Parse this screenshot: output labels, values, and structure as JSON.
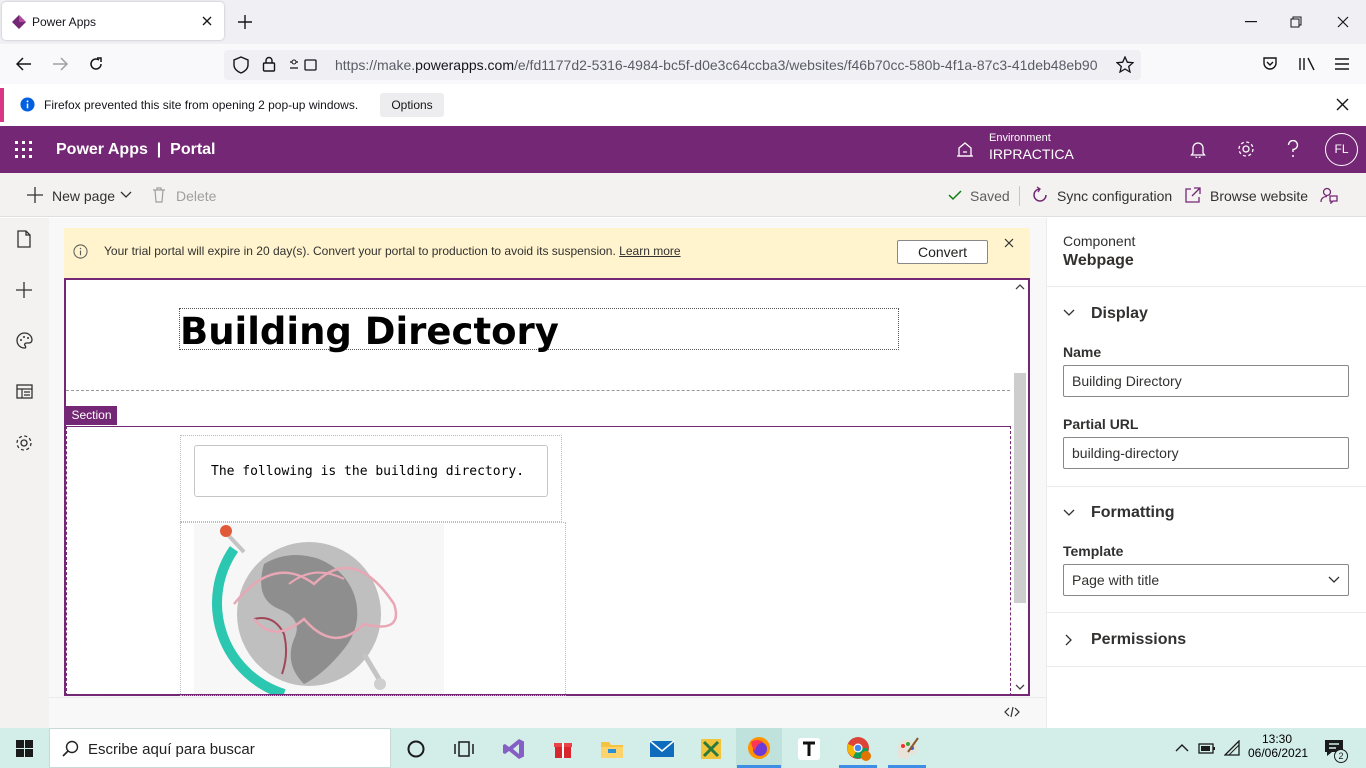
{
  "browser": {
    "tab_title": "Power Apps",
    "url_prefix": "https://make.",
    "url_domain": "powerapps.com",
    "url_rest": "/e/fd1177d2-5316-4984-bc5f-d0e3c64ccba3/websites/f46b70cc-580b-4f1a-87c3-41deb48eb90",
    "notification": "Firefox prevented this site from opening 2 pop-up windows.",
    "notification_options": "Options"
  },
  "header": {
    "app_name": "Power Apps",
    "separator": "|",
    "section": "Portal",
    "environment_label": "Environment",
    "environment_name": "IRPRACTICA",
    "avatar_initials": "FL"
  },
  "toolbar": {
    "new_page": "New page",
    "delete": "Delete",
    "saved": "Saved",
    "sync": "Sync configuration",
    "browse": "Browse website"
  },
  "banner": {
    "message": "Your trial portal will expire in 20 day(s). Convert your portal to production to avoid its suspension.",
    "learn_more": "Learn more",
    "convert": "Convert"
  },
  "canvas": {
    "page_title": "Building Directory",
    "section_label": "Section",
    "body_text": "The following is the building directory."
  },
  "panel": {
    "component_label": "Component",
    "component_type": "Webpage",
    "display_heading": "Display",
    "name_label": "Name",
    "name_value": "Building Directory",
    "url_label": "Partial URL",
    "url_value": "building-directory",
    "formatting_heading": "Formatting",
    "template_label": "Template",
    "template_value": "Page with title",
    "permissions_heading": "Permissions"
  },
  "taskbar": {
    "search_placeholder": "Escribe aquí para buscar",
    "time": "13:30",
    "date": "06/06/2021",
    "notification_count": "2"
  },
  "colors": {
    "brand": "#742774",
    "banner": "#fff4ce",
    "taskbar": "#d3eee9"
  }
}
